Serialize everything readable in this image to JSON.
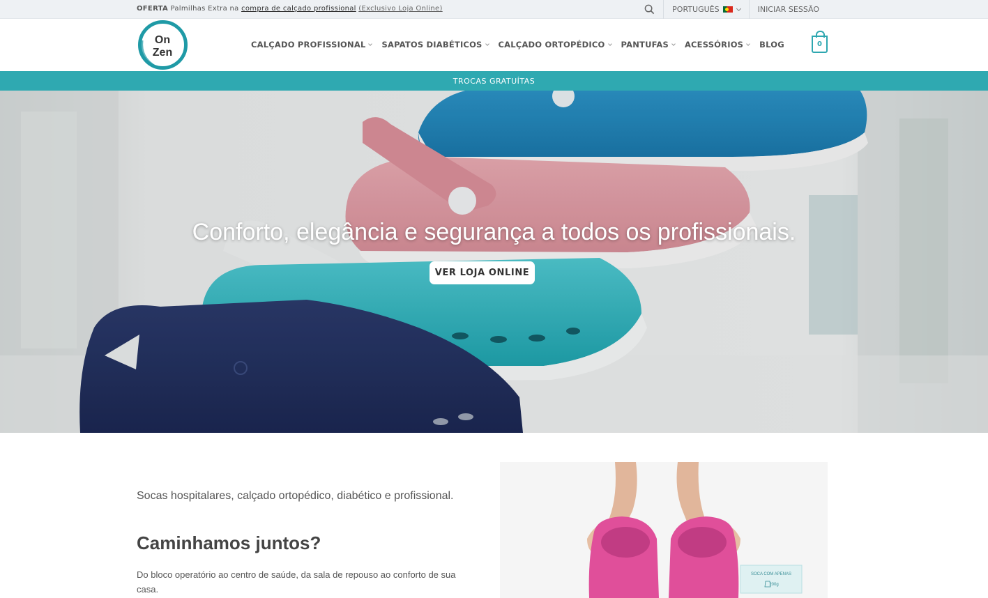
{
  "topbar": {
    "offer_bold": "OFERTA",
    "offer_text": "Palmilhas Extra na",
    "offer_link": "compra de calçado profissional",
    "offer_exclusive": "(Exclusivo Loja Online)",
    "language": "PORTUGUÊS",
    "login": "INICIAR SESSÃO"
  },
  "header": {
    "logo_line1": "On",
    "logo_line2": "Zen",
    "nav": [
      {
        "label": "CALÇADO PROFISSIONAL"
      },
      {
        "label": "SAPATOS DIABÉTICOS"
      },
      {
        "label": "CALÇADO ORTOPÉDICO"
      },
      {
        "label": "PANTUFAS"
      },
      {
        "label": "ACESSÓRIOS"
      },
      {
        "label": "BLOG"
      }
    ],
    "cart_count": "0"
  },
  "strip": {
    "text": "TROCAS GRATUÍTAS"
  },
  "hero": {
    "title": "Conforto, elegância e segurança a todos os profissionais.",
    "button": "VER LOJA ONLINE"
  },
  "content": {
    "intro": "Socas hospitalares, calçado ortopédico, diabético e profissional.",
    "heading": "Caminhamos juntos?",
    "desc": "Do bloco operatório ao centro de saúde, da sala de repouso ao conforto de sua casa."
  },
  "photo": {
    "label_line1": "SOCA COM APENAS",
    "label_line2": "200g"
  },
  "colors": {
    "accent": "#2fa9b1",
    "logo_teal": "#1f9aa6"
  }
}
